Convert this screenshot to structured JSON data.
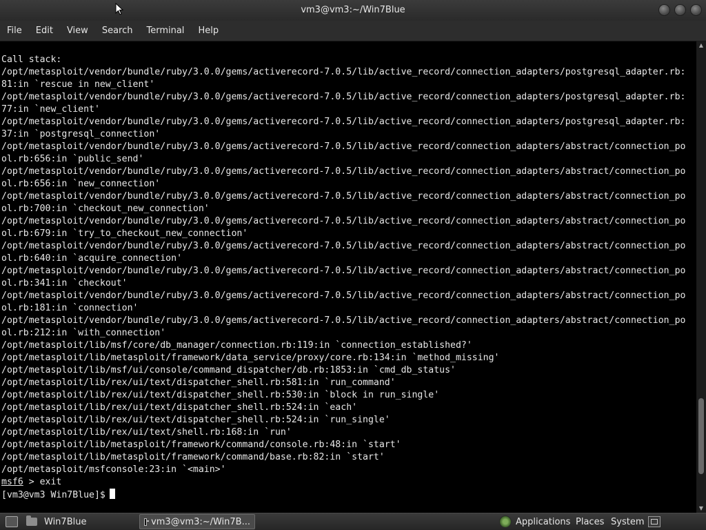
{
  "window": {
    "title": "vm3@vm3:~/Win7Blue"
  },
  "menu": {
    "items": [
      "File",
      "Edit",
      "View",
      "Search",
      "Terminal",
      "Help"
    ]
  },
  "terminal": {
    "lines": [
      "Call stack:",
      "/opt/metasploit/vendor/bundle/ruby/3.0.0/gems/activerecord-7.0.5/lib/active_record/connection_adapters/postgresql_adapter.rb:",
      "81:in `rescue in new_client'",
      "/opt/metasploit/vendor/bundle/ruby/3.0.0/gems/activerecord-7.0.5/lib/active_record/connection_adapters/postgresql_adapter.rb:",
      "77:in `new_client'",
      "/opt/metasploit/vendor/bundle/ruby/3.0.0/gems/activerecord-7.0.5/lib/active_record/connection_adapters/postgresql_adapter.rb:",
      "37:in `postgresql_connection'",
      "/opt/metasploit/vendor/bundle/ruby/3.0.0/gems/activerecord-7.0.5/lib/active_record/connection_adapters/abstract/connection_po",
      "ol.rb:656:in `public_send'",
      "/opt/metasploit/vendor/bundle/ruby/3.0.0/gems/activerecord-7.0.5/lib/active_record/connection_adapters/abstract/connection_po",
      "ol.rb:656:in `new_connection'",
      "/opt/metasploit/vendor/bundle/ruby/3.0.0/gems/activerecord-7.0.5/lib/active_record/connection_adapters/abstract/connection_po",
      "ol.rb:700:in `checkout_new_connection'",
      "/opt/metasploit/vendor/bundle/ruby/3.0.0/gems/activerecord-7.0.5/lib/active_record/connection_adapters/abstract/connection_po",
      "ol.rb:679:in `try_to_checkout_new_connection'",
      "/opt/metasploit/vendor/bundle/ruby/3.0.0/gems/activerecord-7.0.5/lib/active_record/connection_adapters/abstract/connection_po",
      "ol.rb:640:in `acquire_connection'",
      "/opt/metasploit/vendor/bundle/ruby/3.0.0/gems/activerecord-7.0.5/lib/active_record/connection_adapters/abstract/connection_po",
      "ol.rb:341:in `checkout'",
      "/opt/metasploit/vendor/bundle/ruby/3.0.0/gems/activerecord-7.0.5/lib/active_record/connection_adapters/abstract/connection_po",
      "ol.rb:181:in `connection'",
      "/opt/metasploit/vendor/bundle/ruby/3.0.0/gems/activerecord-7.0.5/lib/active_record/connection_adapters/abstract/connection_po",
      "ol.rb:212:in `with_connection'",
      "/opt/metasploit/lib/msf/core/db_manager/connection.rb:119:in `connection_established?'",
      "/opt/metasploit/lib/metasploit/framework/data_service/proxy/core.rb:134:in `method_missing'",
      "/opt/metasploit/lib/msf/ui/console/command_dispatcher/db.rb:1853:in `cmd_db_status'",
      "/opt/metasploit/lib/rex/ui/text/dispatcher_shell.rb:581:in `run_command'",
      "/opt/metasploit/lib/rex/ui/text/dispatcher_shell.rb:530:in `block in run_single'",
      "/opt/metasploit/lib/rex/ui/text/dispatcher_shell.rb:524:in `each'",
      "/opt/metasploit/lib/rex/ui/text/dispatcher_shell.rb:524:in `run_single'",
      "/opt/metasploit/lib/rex/ui/text/shell.rb:168:in `run'",
      "/opt/metasploit/lib/metasploit/framework/command/console.rb:48:in `start'",
      "/opt/metasploit/lib/metasploit/framework/command/base.rb:82:in `start'",
      "/opt/metasploit/msfconsole:23:in `<main>'"
    ],
    "msf_prompt": "msf6",
    "msf_command": " > exit",
    "shell_prompt": "[vm3@vm3 Win7Blue]$"
  },
  "scrollbar": {
    "position_fraction": 0.92
  },
  "taskbar": {
    "folder_label": "Win7Blue",
    "terminal_label": "vm3@vm3:~/Win7B...",
    "applications": "Applications",
    "places": "Places",
    "system": "System"
  },
  "icons": {
    "window_controls": [
      "minimize-icon",
      "maximize-icon",
      "close-icon"
    ],
    "taskbar": [
      "show-desktop-icon",
      "folder-icon",
      "terminal-icon",
      "applications-icon",
      "system-tray-icon"
    ]
  }
}
